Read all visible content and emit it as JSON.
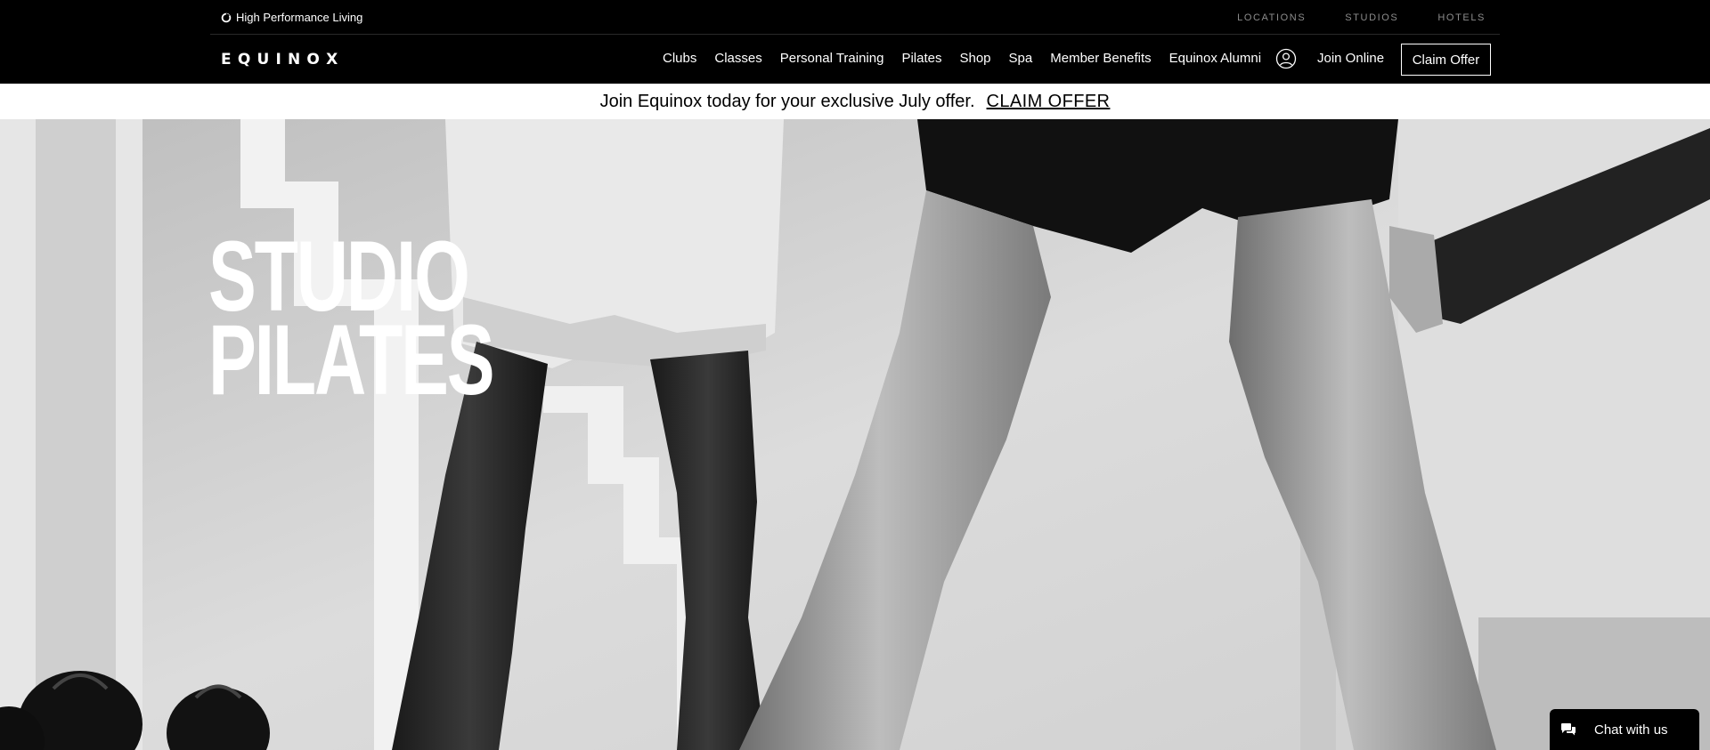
{
  "header": {
    "tagline": "High Performance Living",
    "utility_links": [
      "LOCATIONS",
      "STUDIOS",
      "HOTELS"
    ],
    "logo": "EQUINO",
    "logo_last": "X",
    "nav": [
      "Clubs",
      "Classes",
      "Personal Training",
      "Pilates",
      "Shop",
      "Spa",
      "Member Benefits",
      "Equinox Alumni"
    ],
    "join_online": "Join Online",
    "claim_offer": "Claim Offer"
  },
  "promo": {
    "text": "Join Equinox today for your exclusive July offer.",
    "link": "CLAIM OFFER"
  },
  "hero": {
    "title_line1": "STUDIO",
    "title_line2": "PILATES"
  },
  "chat": {
    "label": "Chat with us"
  },
  "icons": {
    "tagline_icon": "ring-icon",
    "account": "user-circle-icon",
    "chat": "chat-bubbles-icon"
  },
  "colors": {
    "header_bg": "#000000",
    "utility_text": "#8c8c8c",
    "promo_bg": "#ffffff"
  }
}
